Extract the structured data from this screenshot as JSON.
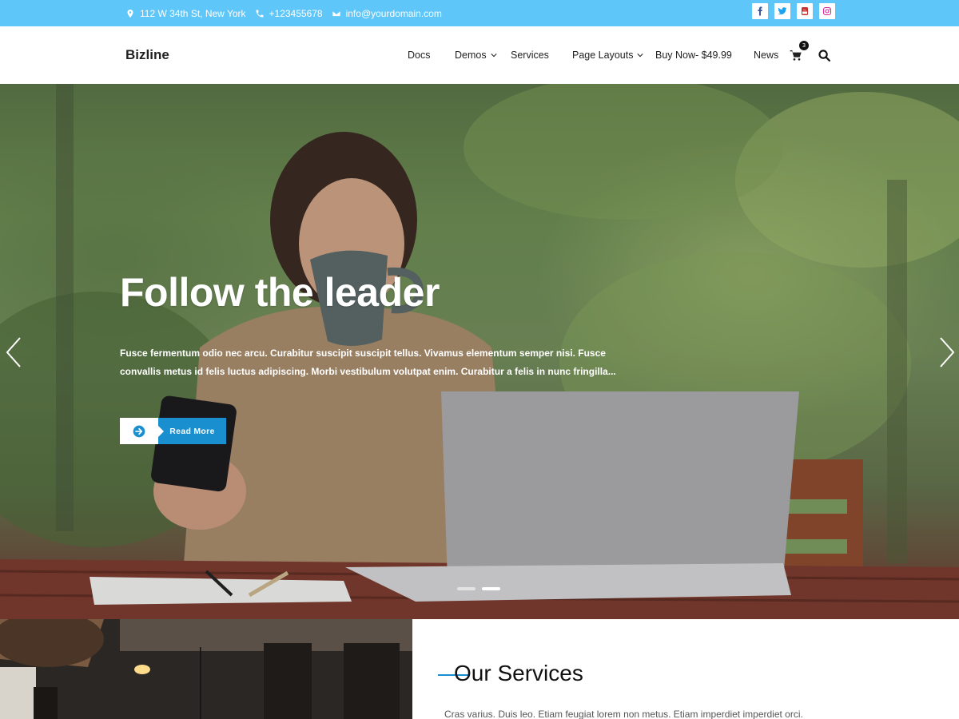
{
  "topbar": {
    "address": "112 W 34th St, New York",
    "phone": "+123455678",
    "email": "info@yourdomain.com",
    "social": [
      "facebook-icon",
      "twitter-icon",
      "youtube-icon",
      "instagram-icon"
    ],
    "bg_color": "#5ec6f8"
  },
  "header": {
    "brand": "Bizline",
    "nav": [
      {
        "label": "Docs",
        "dropdown": false
      },
      {
        "label": "Demos",
        "dropdown": true
      },
      {
        "label": "Services",
        "dropdown": false
      },
      {
        "label": "Page Layouts",
        "dropdown": true
      },
      {
        "label": "Buy Now- $49.99",
        "dropdown": false
      },
      {
        "label": "News",
        "dropdown": false
      }
    ],
    "cart_count": "3"
  },
  "hero": {
    "title": "Follow the leader",
    "description": "Fusce fermentum odio nec arcu. Curabitur suscipit suscipit tellus. Vivamus elementum semper nisi. Fusce convallis metus id felis luctus adipiscing. Morbi vestibulum volutpat enim. Curabitur a felis in nunc fringilla...",
    "button_label": "Read More",
    "slides": 2,
    "active_slide": 2,
    "accent_color": "#1a8fd0"
  },
  "services": {
    "heading": "Our Services",
    "text": "Cras varius. Duis leo. Etiam feugiat lorem non metus. Etiam imperdiet imperdiet orci."
  }
}
